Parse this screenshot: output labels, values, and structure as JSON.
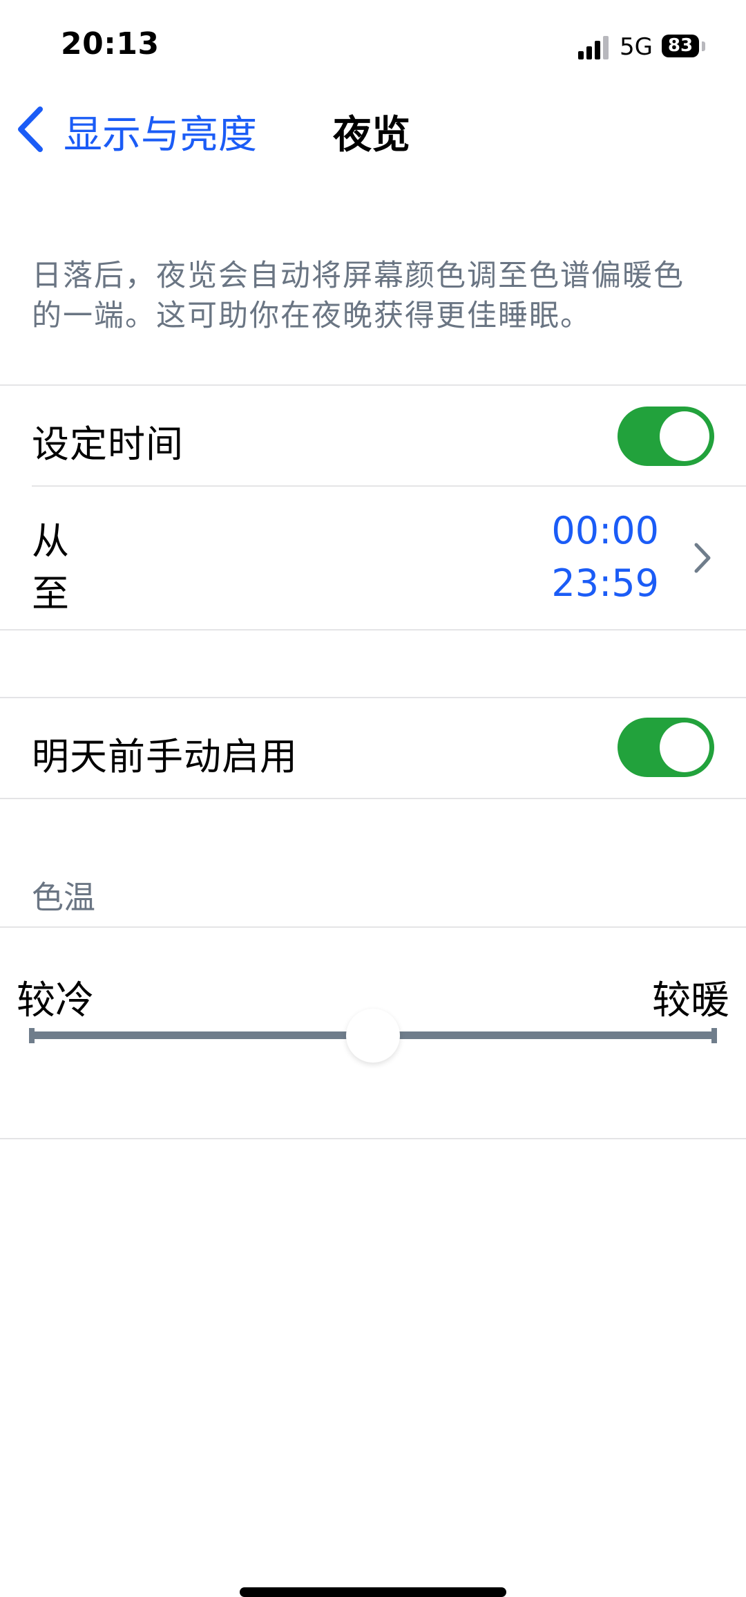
{
  "status_bar": {
    "time": "20:13",
    "network": "5G",
    "battery_level": "83"
  },
  "nav": {
    "back_label": "显示与亮度",
    "title": "夜览"
  },
  "description": "日落后，夜览会自动将屏幕颜色调至色谱偏暖色的一端。这可助你在夜晚获得更佳睡眠。",
  "schedule": {
    "label": "设定时间",
    "enabled": true,
    "from_label": "从",
    "to_label": "至",
    "from_time": "00:00",
    "to_time": "23:59"
  },
  "manual": {
    "label": "明天前手动启用",
    "enabled": true
  },
  "color_temperature": {
    "header": "色温",
    "min_label": "较冷",
    "max_label": "较暖",
    "value_fraction": 0.5
  },
  "colors": {
    "accent": "#1b5cf6",
    "toggle_on": "#22a23c",
    "secondary_text": "#6a7583",
    "slider_track": "#6f7d8b"
  },
  "icons": {
    "back": "chevron-left-icon",
    "disclosure": "chevron-right-icon",
    "signal": "cellular-signal-icon",
    "battery": "battery-icon"
  }
}
